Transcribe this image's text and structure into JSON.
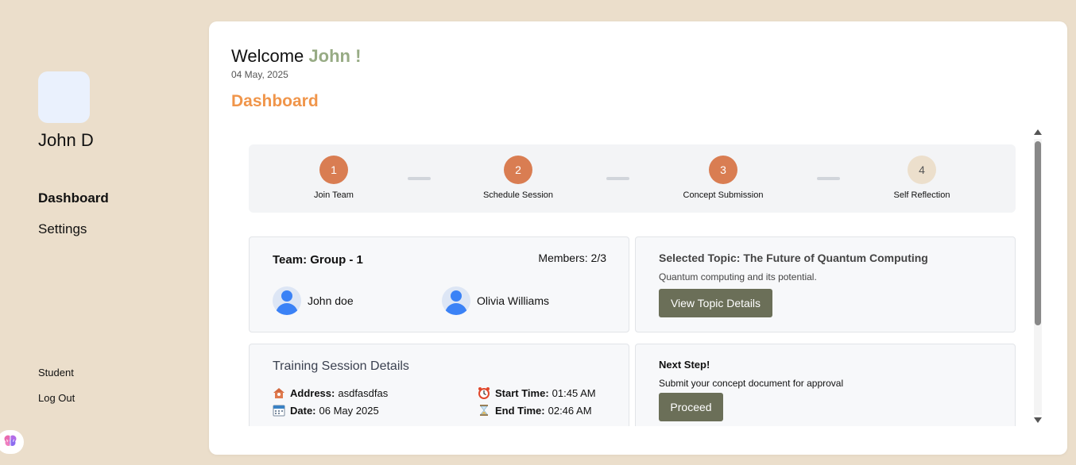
{
  "sidebar": {
    "user_name": "John D",
    "nav": [
      {
        "label": "Dashboard"
      },
      {
        "label": "Settings"
      }
    ],
    "role": "Student",
    "logout_label": "Log Out"
  },
  "header": {
    "welcome_prefix": "Welcome ",
    "welcome_name": "John !",
    "date": "04 May, 2025",
    "page_title": "Dashboard"
  },
  "stepper": {
    "steps": [
      {
        "number": "1",
        "label": "Join Team",
        "status": "done"
      },
      {
        "number": "2",
        "label": "Schedule Session",
        "status": "done"
      },
      {
        "number": "3",
        "label": "Concept Submission",
        "status": "done"
      },
      {
        "number": "4",
        "label": "Self Reflection",
        "status": "pending"
      }
    ]
  },
  "team": {
    "title": "Team: Group - 1",
    "members_label": "Members: 2/3",
    "members": [
      {
        "name": "John doe"
      },
      {
        "name": "Olivia Williams"
      }
    ]
  },
  "topic": {
    "title": "Selected Topic: The Future of Quantum Computing",
    "description": "Quantum computing and its potential.",
    "button_label": "View Topic Details"
  },
  "training": {
    "title": "Training Session Details",
    "address_label": "Address:",
    "address_value": "asdfasdfas",
    "date_label": "Date:",
    "date_value": "06 May 2025",
    "start_label": "Start Time:",
    "start_value": "01:45 AM",
    "end_label": "End Time:",
    "end_value": "02:46 AM"
  },
  "next_step": {
    "title": "Next Step!",
    "description": "Submit your concept document for approval",
    "button_label": "Proceed"
  },
  "colors": {
    "background": "#ebdecb",
    "accent_orange": "#f0954a",
    "welcome_green": "#97ab84",
    "step_done": "#d97d52",
    "step_pending": "#ecdfcc",
    "button": "#6b6f58"
  },
  "icons": [
    "house-icon",
    "calendar-icon",
    "alarm-clock-icon",
    "hourglass-icon",
    "user-icon",
    "brain-icon"
  ]
}
